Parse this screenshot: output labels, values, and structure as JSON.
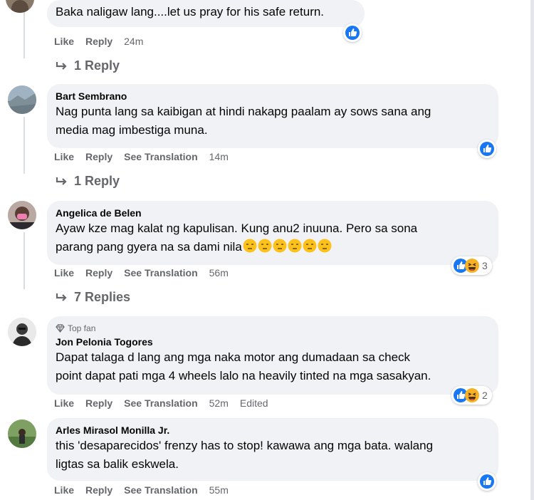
{
  "comments": [
    {
      "text": "Baka naligaw lang....let us pray for his safe return.",
      "actions": {
        "like": "Like",
        "reply": "Reply",
        "time": "24m"
      },
      "replies_label": "1 Reply"
    },
    {
      "author": "Bart Sembrano",
      "text_line1": "Nag punta lang sa kaibigan at hindi nakapg paalam ay sows sana ang",
      "text_line2": "media mag imbestiga muna.",
      "actions": {
        "like": "Like",
        "reply": "Reply",
        "translate": "See Translation",
        "time": "14m"
      },
      "replies_label": "1 Reply"
    },
    {
      "author": "Angelica de Belen",
      "text_line1": "Ayaw kze mag kalat ng kapulisan. Kung anu2 inuuna. Pero sa sona",
      "text_line2": "parang pang gyera na sa dami nila",
      "actions": {
        "like": "Like",
        "reply": "Reply",
        "translate": "See Translation",
        "time": "56m"
      },
      "reaction_count": "3",
      "replies_label": "7 Replies"
    },
    {
      "badge": "Top fan",
      "author": "Jon Pelonia Togores",
      "text_line1": "Dapat talaga d lang ang mga naka motor ang dumadaan sa check",
      "text_line2": "point dapat pati mga 4 wheels lalo na heavily tinted na mga sasakyan.",
      "actions": {
        "like": "Like",
        "reply": "Reply",
        "translate": "See Translation",
        "time": "52m",
        "edited": "Edited"
      },
      "reaction_count": "2"
    },
    {
      "author": "Arles Mirasol Monilla Jr.",
      "text_line1": "this 'desaparecidos' frenzy has to stop! kawawa ang mga bata. walang",
      "text_line2": "ligtas sa balik eskwela.",
      "actions": {
        "like": "Like",
        "reply": "Reply",
        "translate": "See Translation",
        "time": "55m"
      }
    }
  ],
  "colors": {
    "bubble": "#f0f2f5",
    "meta": "#65676b",
    "like_blue": "#1877f2",
    "haha_yellow": "#f7b125"
  },
  "icons": [
    "like-reaction-icon",
    "haha-reaction-icon",
    "reply-arrow-icon",
    "diamond-icon",
    "unamused-emoji-icon"
  ]
}
